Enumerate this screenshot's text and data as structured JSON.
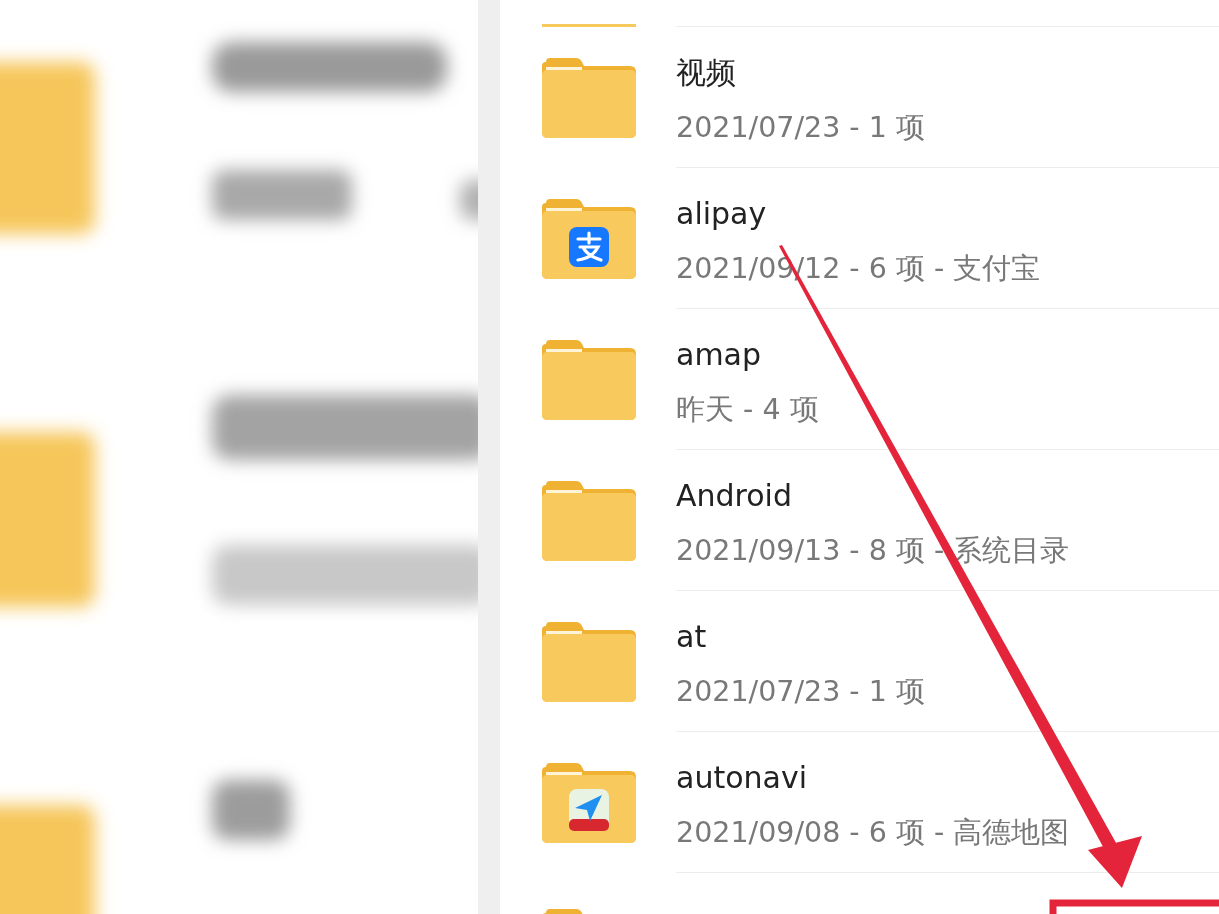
{
  "folders": [
    {
      "kind": "cut-top"
    },
    {
      "kind": "plain",
      "name": "视频",
      "details": "2021/07/23 - 1 项"
    },
    {
      "kind": "app-pay",
      "name": "alipay",
      "details": "2021/09/12 - 6 项 - 支付宝"
    },
    {
      "kind": "plain",
      "name": "amap",
      "details": "昨天 - 4 项"
    },
    {
      "kind": "plain",
      "name": "Android",
      "details": "2021/09/13 - 8 项 - 系统目录"
    },
    {
      "kind": "plain",
      "name": "at",
      "details": "2021/07/23 - 1 项"
    },
    {
      "kind": "app-map",
      "name": "autonavi",
      "details": "2021/09/08 - 6 项 - 高德地图"
    },
    {
      "kind": "cut-bottom"
    }
  ]
}
